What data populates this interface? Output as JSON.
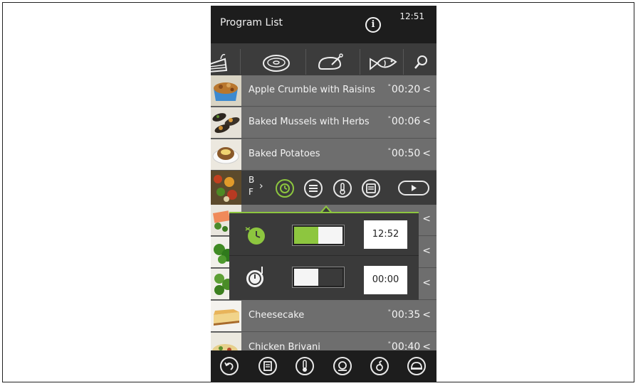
{
  "header": {
    "title": "Program List",
    "time": "12:51"
  },
  "categories": [
    {
      "icon": "cake-icon"
    },
    {
      "icon": "meat-icon"
    },
    {
      "icon": "poultry-icon"
    },
    {
      "icon": "fish-icon"
    },
    {
      "icon": "search-icon"
    }
  ],
  "programs": [
    {
      "name": "Apple Crumble with Raisins",
      "time": "00:20"
    },
    {
      "name": "Baked Mussels with Herbs",
      "time": "00:06"
    },
    {
      "name": "Baked Potatoes",
      "time": "00:50"
    },
    {
      "name": "Cheesecake",
      "time": "00:35"
    },
    {
      "name": "Chicken Brivani",
      "time": "00:40"
    }
  ],
  "expanded_row_clip": [
    "B",
    "F"
  ],
  "action_icons": [
    "timer-icon",
    "list-icon",
    "thermometer-icon",
    "recipe-book-icon",
    "play-icon"
  ],
  "popup": {
    "rows": [
      {
        "icon": "delayed-start-icon",
        "toggle_on": true,
        "time": "12:52"
      },
      {
        "icon": "end-time-clock-icon",
        "toggle_on": false,
        "time": "00:00"
      }
    ]
  },
  "bottom_icons": [
    "back-icon",
    "book-icon",
    "core-probe-icon",
    "steam-icon",
    "delta-icon",
    "dish-cover-icon"
  ],
  "colors": {
    "accent": "#8dc63f",
    "bar": "#1d1d1d",
    "row": "#6e6e6e",
    "popup": "#3a3a3a"
  }
}
